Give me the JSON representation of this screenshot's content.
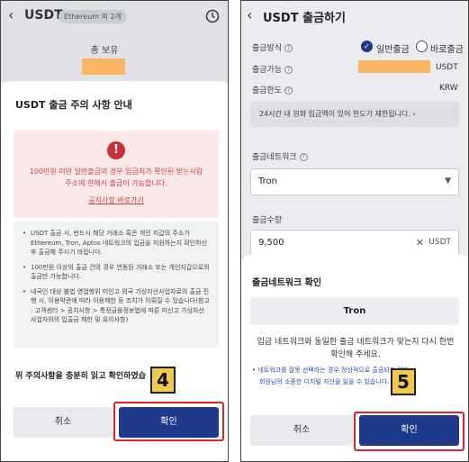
{
  "left": {
    "back_glyph": "‹",
    "header_title": "USDT",
    "network_chip": "Ethereum 외 2개",
    "total_label": "총 보유",
    "sheet_title": "USDT 출금 주의 사항 안내",
    "warning_icon": "!",
    "warning_lines": [
      "100만원 미만 일반출금의 경우 입금처가 확인된 받는사람",
      "주소에 한해서 출금이 가능합니다."
    ],
    "warning_link": "공지사항 바로가기",
    "notes": [
      "USDT 출금 시, 반드시 해당 거래소 혹은 개인 지갑의 주소가 Ethereum, Tron, Aptos 네트워크의 입금을 지원하는지 확인하신 후 출금해 주시기 바랍니다.",
      "100만원 이상의 출금 건의 경우 연동된 거래소 또는 개인지갑으로의 출금만 가능합니다.",
      "내국인 대상 불법 영업행위 미인고 외국 가상자산사업자로의 출금 진행 시, 이용약관에 따라 이용제한 등 조치가 이뤄질 수 있습니다(참고 : 고객센터 > 공지사항 > 특정금융정보법에 따른 미신고 가상자산사업자와의 입출금 제한 및 유의사항)"
    ],
    "confirm_text": "위 주의사항을 충분히 읽고 확인하였습",
    "step_number": "4",
    "cancel_label": "취소",
    "confirm_label": "확인"
  },
  "right": {
    "back_glyph": "‹",
    "header_title": "USDT 출금하기",
    "method_label": "출금방식",
    "method_option_normal": "일반출금",
    "method_option_quick": "바로출금",
    "available_label": "출금가능",
    "available_unit": "USDT",
    "limit_label": "출금한도",
    "limit_unit": "KRW",
    "limit_note": "24시간 내 원화 입금액이 있어 한도가 제한됩니다.",
    "network_label": "출금네트워크",
    "network_value": "Tron",
    "amount_label": "출금수량",
    "amount_value": "9,500",
    "amount_unit": "USDT",
    "sheet_title": "출금네트워크 확인",
    "sheet_network": "Tron",
    "sheet_message_lines": [
      "입금 네트워크와 동일한 출금 네트워크가 맞는지 다시 한번",
      "확인해 주세요."
    ],
    "sheet_notes": [
      "네트워크를 잘못 선택하는 경우 정상적으로 출금되지 않아",
      "회원님의 소중한 디지털 자산을 잃을 수 있습니다."
    ],
    "step_number": "5",
    "cancel_label": "취소",
    "confirm_label": "확인"
  },
  "icons": {
    "history": "history-icon",
    "clear": "clear-icon",
    "dropdown": "chevron-down-icon",
    "check": "check-icon"
  },
  "colors": {
    "confirm_button": "#1f3a8a",
    "warning_red": "#c9303a",
    "step_badge": "#f2c94c",
    "highlight_border": "#e0212d",
    "redaction": "#fbb462"
  }
}
